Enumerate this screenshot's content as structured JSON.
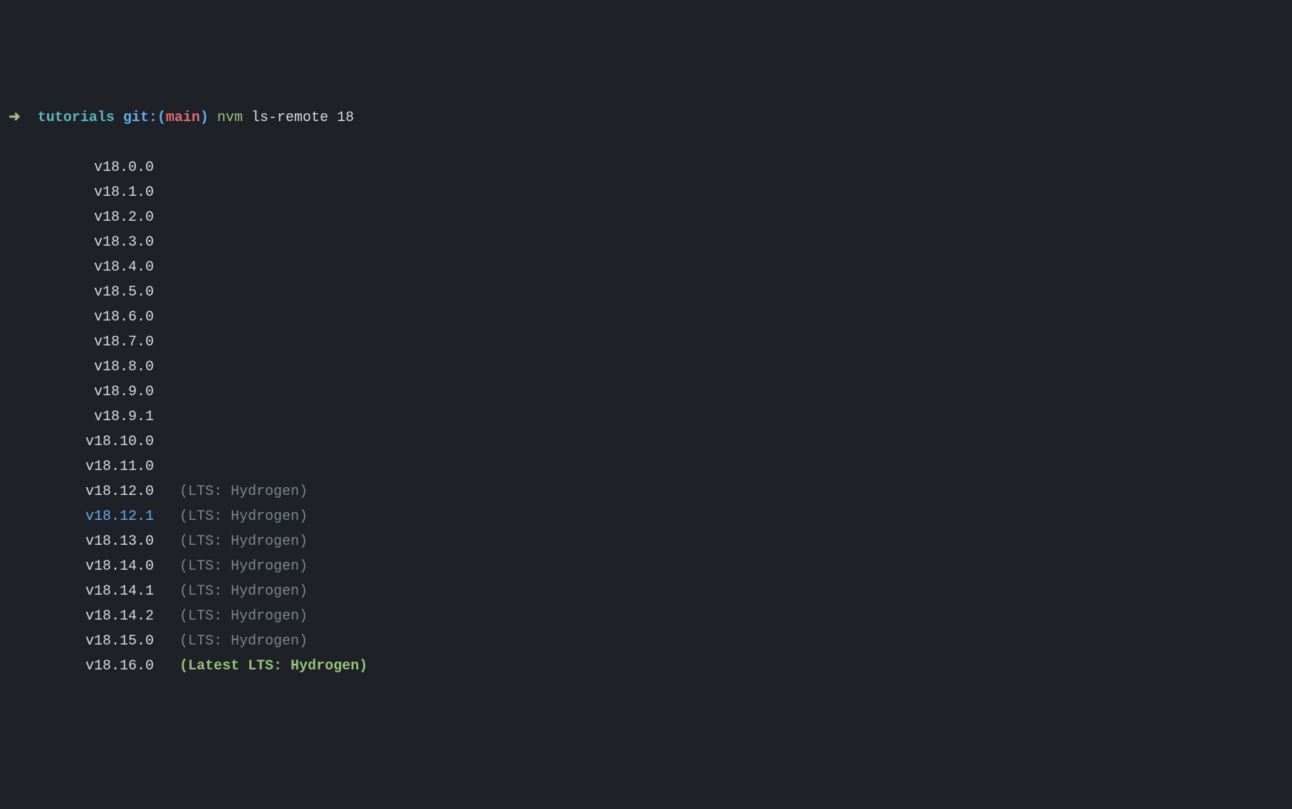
{
  "prompt": {
    "arrow": "➜",
    "directory": "tutorials",
    "git_prefix": "git:(",
    "branch": "main",
    "git_suffix": ")",
    "command_bin": "nvm",
    "command_args": "ls-remote 18"
  },
  "output": [
    {
      "version": "v18.0.0",
      "annotation": "",
      "current": false,
      "latest": false
    },
    {
      "version": "v18.1.0",
      "annotation": "",
      "current": false,
      "latest": false
    },
    {
      "version": "v18.2.0",
      "annotation": "",
      "current": false,
      "latest": false
    },
    {
      "version": "v18.3.0",
      "annotation": "",
      "current": false,
      "latest": false
    },
    {
      "version": "v18.4.0",
      "annotation": "",
      "current": false,
      "latest": false
    },
    {
      "version": "v18.5.0",
      "annotation": "",
      "current": false,
      "latest": false
    },
    {
      "version": "v18.6.0",
      "annotation": "",
      "current": false,
      "latest": false
    },
    {
      "version": "v18.7.0",
      "annotation": "",
      "current": false,
      "latest": false
    },
    {
      "version": "v18.8.0",
      "annotation": "",
      "current": false,
      "latest": false
    },
    {
      "version": "v18.9.0",
      "annotation": "",
      "current": false,
      "latest": false
    },
    {
      "version": "v18.9.1",
      "annotation": "",
      "current": false,
      "latest": false
    },
    {
      "version": "v18.10.0",
      "annotation": "",
      "current": false,
      "latest": false
    },
    {
      "version": "v18.11.0",
      "annotation": "",
      "current": false,
      "latest": false
    },
    {
      "version": "v18.12.0",
      "annotation": "(LTS: Hydrogen)",
      "current": false,
      "latest": false
    },
    {
      "version": "v18.12.1",
      "annotation": "(LTS: Hydrogen)",
      "current": true,
      "latest": false
    },
    {
      "version": "v18.13.0",
      "annotation": "(LTS: Hydrogen)",
      "current": false,
      "latest": false
    },
    {
      "version": "v18.14.0",
      "annotation": "(LTS: Hydrogen)",
      "current": false,
      "latest": false
    },
    {
      "version": "v18.14.1",
      "annotation": "(LTS: Hydrogen)",
      "current": false,
      "latest": false
    },
    {
      "version": "v18.14.2",
      "annotation": "(LTS: Hydrogen)",
      "current": false,
      "latest": false
    },
    {
      "version": "v18.15.0",
      "annotation": "(LTS: Hydrogen)",
      "current": false,
      "latest": false
    },
    {
      "version": "v18.16.0",
      "annotation": "(Latest LTS: Hydrogen)",
      "current": false,
      "latest": true
    }
  ]
}
